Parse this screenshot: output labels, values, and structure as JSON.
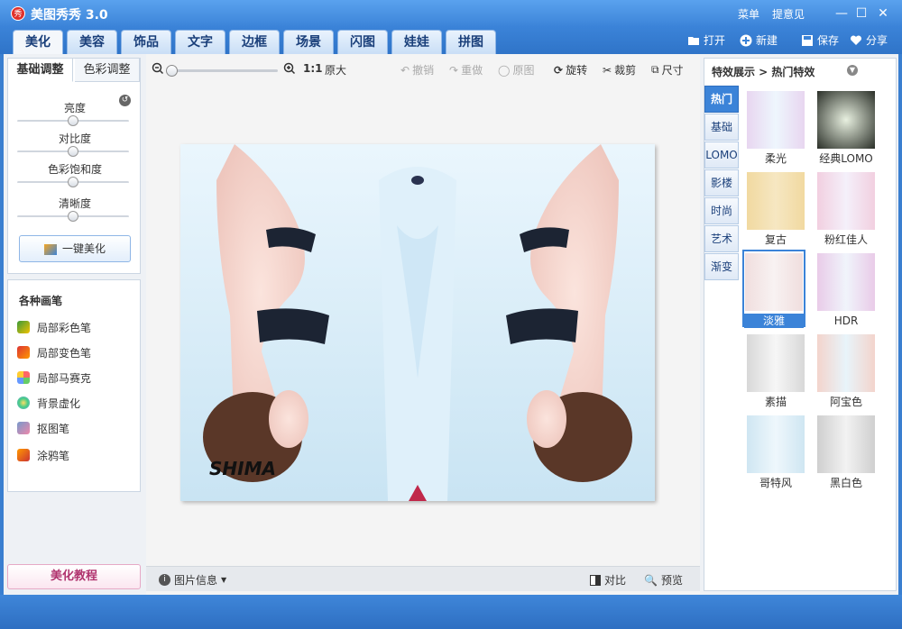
{
  "app": {
    "logo_text": "秀",
    "title": "美图秀秀 3.0",
    "menu": "菜单",
    "feedback": "提意见"
  },
  "window": {
    "minimize": "—",
    "maximize": "☐",
    "close": "✕"
  },
  "tabs": [
    "美化",
    "美容",
    "饰品",
    "文字",
    "边框",
    "场景",
    "闪图",
    "娃娃",
    "拼图"
  ],
  "toolbar": {
    "open": "打开",
    "new": "新建",
    "save": "保存",
    "share": "分享"
  },
  "left": {
    "subtabs": [
      "基础调整",
      "色彩调整"
    ],
    "sliders": [
      {
        "label": "亮度",
        "value": 0.5
      },
      {
        "label": "对比度",
        "value": 0.5
      },
      {
        "label": "色彩饱和度",
        "value": 0.5
      },
      {
        "label": "清晰度",
        "value": 0.5
      }
    ],
    "onekey": "一键美化",
    "brushes_title": "各种画笔",
    "brushes": [
      "局部彩色笔",
      "局部变色笔",
      "局部马赛克",
      "背景虚化",
      "抠图笔",
      "涂鸦笔"
    ],
    "tutorial": "美化教程"
  },
  "center": {
    "zoom_ratio": "1:1",
    "zoom_orig": "原大",
    "zoom_value": 0.0,
    "undo": "撤销",
    "redo": "重做",
    "original": "原图",
    "rotate": "旋转",
    "crop": "裁剪",
    "size": "尺寸",
    "watermark": "SHIMA",
    "info": "图片信息",
    "compare": "对比",
    "preview": "预览"
  },
  "right": {
    "breadcrumb": "特效展示 > 热门特效",
    "categories": [
      "热门",
      "基础",
      "LOMO",
      "影楼",
      "时尚",
      "艺术",
      "渐变"
    ],
    "effects": [
      "柔光",
      "经典LOMO",
      "复古",
      "粉红佳人",
      "淡雅",
      "HDR",
      "素描",
      "阿宝色",
      "哥特风",
      "黑白色"
    ],
    "selected_effect": "淡雅"
  },
  "colors": {
    "accent": "#3b83d8",
    "title_bar": "#4a93e3"
  }
}
